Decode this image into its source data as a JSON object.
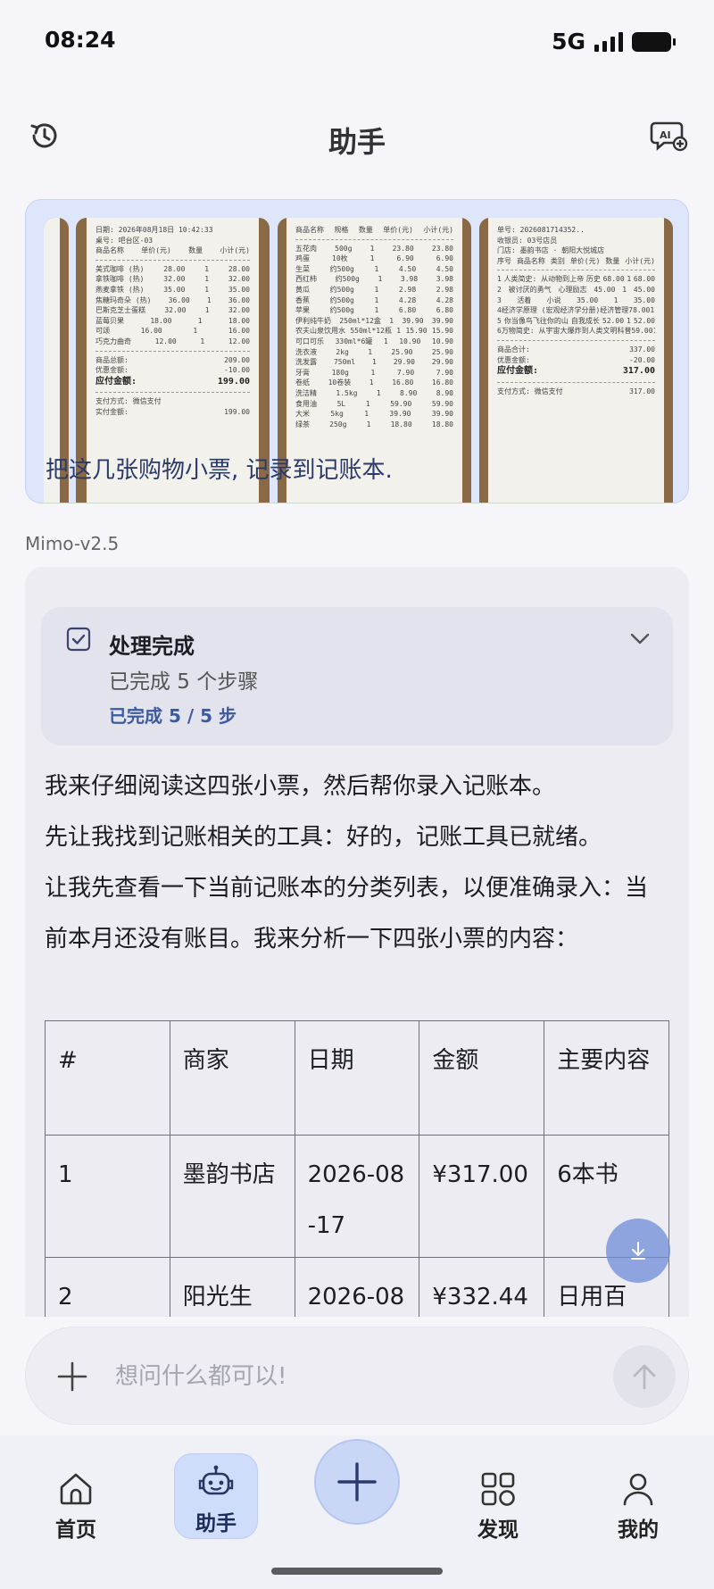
{
  "status_bar": {
    "time": "08:24",
    "network": "5G"
  },
  "header": {
    "title": "助手",
    "left_icon": "history-icon",
    "right_icon": "ai-chat-icon"
  },
  "user_message": {
    "text": "把这几张购物小票, 记录到记账本.",
    "receipts": [
      {
        "rows_header": [
          "日期: 2026年08月18日 10:42:33",
          "桌号: 吧台区-03"
        ],
        "cols": [
          "商品名称",
          "单价(元)",
          "数量",
          "小计(元)"
        ],
        "items": [
          [
            "美式咖啡 (热)",
            "28.00",
            "1",
            "28.00"
          ],
          [
            "拿铁咖啡 (热)",
            "32.00",
            "1",
            "32.00"
          ],
          [
            "燕麦拿铁 (热)",
            "35.00",
            "1",
            "35.00"
          ],
          [
            "焦糖玛奇朵 (热)",
            "36.00",
            "1",
            "36.00"
          ],
          [
            "巴斯克芝士蛋糕",
            "32.00",
            "1",
            "32.00"
          ],
          [
            "蓝莓贝果",
            "18.00",
            "1",
            "18.00"
          ],
          [
            "可颂",
            "16.00",
            "1",
            "16.00"
          ],
          [
            "巧克力曲奇",
            "12.00",
            "1",
            "12.00"
          ]
        ],
        "totals": [
          [
            "商品总额:",
            "209.00"
          ],
          [
            "优惠金额:",
            "-10.00"
          ],
          [
            "应付金额:",
            "199.00"
          ]
        ],
        "footer": [
          [
            "支付方式: 微信支付",
            ""
          ],
          [
            "实付金额:",
            "199.00"
          ]
        ]
      },
      {
        "cols": [
          "商品名称",
          "规格",
          "数量",
          "单价(元)",
          "小计(元)"
        ],
        "items": [
          [
            "五花肉",
            "500g",
            "1",
            "23.80",
            "23.80"
          ],
          [
            "鸡蛋",
            "10枚",
            "1",
            "6.90",
            "6.90"
          ],
          [
            "生菜",
            "约500g",
            "1",
            "4.50",
            "4.50"
          ],
          [
            "西红柿",
            "约500g",
            "1",
            "3.98",
            "3.98"
          ],
          [
            "黄瓜",
            "约500g",
            "1",
            "2.98",
            "2.98"
          ],
          [
            "香蕉",
            "约500g",
            "1",
            "4.28",
            "4.28"
          ],
          [
            "苹果",
            "约500g",
            "1",
            "6.80",
            "6.80"
          ],
          [
            "伊利纯牛奶",
            "250ml*12盒",
            "1",
            "39.90",
            "39.90"
          ],
          [
            "农夫山泉饮用水",
            "550ml*12瓶",
            "1",
            "15.90",
            "15.90"
          ],
          [
            "可口可乐",
            "330ml*6罐",
            "1",
            "10.90",
            "10.90"
          ],
          [
            "洗衣液",
            "2kg",
            "1",
            "25.90",
            "25.90"
          ],
          [
            "洗发露",
            "750ml",
            "1",
            "29.90",
            "29.90"
          ],
          [
            "牙膏",
            "180g",
            "1",
            "7.90",
            "7.90"
          ],
          [
            "卷纸",
            "10卷装",
            "1",
            "16.80",
            "16.80"
          ],
          [
            "洗洁精",
            "1.5kg",
            "1",
            "8.90",
            "8.90"
          ],
          [
            "食用油",
            "5L",
            "1",
            "59.90",
            "59.90"
          ],
          [
            "大米",
            "5kg",
            "1",
            "39.90",
            "39.90"
          ],
          [
            "绿茶",
            "250g",
            "1",
            "18.80",
            "18.80"
          ]
        ]
      },
      {
        "rows_header": [
          "单号: 2026081714352..",
          "收银员: 03号店员",
          "门店: 墨韵书店 · 朝阳大悦城店"
        ],
        "cols": [
          "序号",
          "商品名称",
          "类别",
          "单价(元)",
          "数量",
          "小计(元)"
        ],
        "items": [
          [
            "1",
            "人类简史: 从动物到上帝",
            "历史",
            "68.00",
            "1",
            "68.00"
          ],
          [
            "2",
            "被讨厌的勇气",
            "心理励志",
            "45.00",
            "1",
            "45.00"
          ],
          [
            "3",
            "活着",
            "小说",
            "35.00",
            "1",
            "35.00"
          ],
          [
            "4",
            "经济学原理 (宏观经济学分册)",
            "经济管理",
            "78.00",
            "1",
            "78.00"
          ],
          [
            "5",
            "你当像鸟飞往你的山",
            "自我成长",
            "52.00",
            "1",
            "52.00"
          ],
          [
            "6",
            "万物简史: 从宇宙大爆炸到人类文明",
            "科普",
            "59.00",
            "1",
            "59.00"
          ]
        ],
        "totals": [
          [
            "商品合计:",
            "337.00"
          ],
          [
            "优惠金额:",
            "-20.00"
          ],
          [
            "应付金额:",
            "317.00"
          ]
        ],
        "footer": [
          [
            "支付方式: 微信支付",
            "317.00"
          ]
        ]
      }
    ]
  },
  "model_label": "Mimo-v2.5",
  "steps": {
    "title": "处理完成",
    "subtitle": "已完成 5 个步骤",
    "progress": "已完成 5 / 5 步"
  },
  "paragraphs": [
    "我来仔细阅读这四张小票，然后帮你录入记账本。",
    "先让我找到记账相关的工具：好的，记账工具已就绪。",
    "让我先查看一下当前记账本的分类列表，以便准确录入：当前本月还没有账目。我来分析一下四张小票的内容："
  ],
  "table": {
    "headers": [
      "#",
      "商家",
      "日期",
      "金额",
      "主要内容"
    ],
    "rows": [
      [
        "1",
        "墨韵书店",
        "2026-08-17",
        "¥317.00",
        "6本书"
      ],
      [
        "2",
        "阳光生",
        "2026-08",
        "¥332.44",
        "日用百"
      ]
    ]
  },
  "input": {
    "placeholder": "想问什么都可以!"
  },
  "nav": {
    "home": "首页",
    "assistant": "助手",
    "discover": "发现",
    "mine": "我的"
  }
}
